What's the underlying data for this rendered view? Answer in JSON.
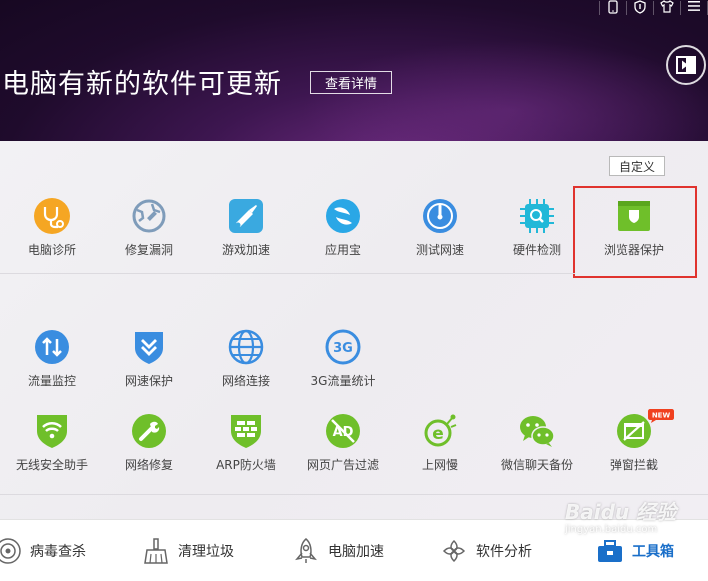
{
  "header": {
    "headline": "电脑有新的软件可更新",
    "detail_button": "查看详情",
    "top_icons": [
      "phone-icon",
      "shield-icon",
      "shirt-icon",
      "menu-icon"
    ]
  },
  "toolbar": {
    "custom_label": "自定义"
  },
  "tools_row1": [
    {
      "label": "电脑诊所",
      "icon": "stethoscope-icon",
      "color": "#f5a623"
    },
    {
      "label": "修复漏洞",
      "icon": "repair-globe-icon",
      "color": "#6f8fb0"
    },
    {
      "label": "游戏加速",
      "icon": "game-boost-icon",
      "color": "#3aa9e0"
    },
    {
      "label": "应用宝",
      "icon": "app-store-icon",
      "color": "#2aa7e6"
    },
    {
      "label": "测试网速",
      "icon": "speed-test-icon",
      "color": "#3a8de0"
    },
    {
      "label": "硬件检测",
      "icon": "chip-icon",
      "color": "#22b8d8"
    },
    {
      "label": "浏览器保护",
      "icon": "browser-shield-icon",
      "color": "#6fbf2a"
    }
  ],
  "tools_row2": [
    {
      "label": "流量监控",
      "icon": "traffic-monitor-icon",
      "color": "#3a8de0"
    },
    {
      "label": "网速保护",
      "icon": "speed-shield-icon",
      "color": "#3a8de0"
    },
    {
      "label": "网络连接",
      "icon": "network-globe-icon",
      "color": "#3a8de0"
    },
    {
      "label": "3G流量统计",
      "icon": "3g-icon",
      "color": "#3a8de0"
    }
  ],
  "tools_row3": [
    {
      "label": "无线安全助手",
      "icon": "wifi-shield-icon",
      "color": "#6fbf2a"
    },
    {
      "label": "网络修复",
      "icon": "wrench-icon",
      "color": "#6fbf2a"
    },
    {
      "label": "ARP防火墙",
      "icon": "firewall-icon",
      "color": "#6fbf2a"
    },
    {
      "label": "网页广告过滤",
      "icon": "ad-filter-icon",
      "color": "#6fbf2a"
    },
    {
      "label": "上网慢",
      "icon": "slow-internet-icon",
      "color": "#6fbf2a"
    },
    {
      "label": "微信聊天备份",
      "icon": "wechat-icon",
      "color": "#6fbf2a"
    },
    {
      "label": "弹窗拦截",
      "icon": "popup-block-icon",
      "color": "#6fbf2a",
      "badge": "NEW"
    }
  ],
  "bottom_nav": [
    {
      "label": "病毒查杀",
      "icon": "virus-scan-icon"
    },
    {
      "label": "清理垃圾",
      "icon": "broom-icon"
    },
    {
      "label": "电脑加速",
      "icon": "rocket-icon"
    },
    {
      "label": "软件分析",
      "icon": "software-icon"
    },
    {
      "label": "工具箱",
      "icon": "toolbox-icon",
      "active": true
    }
  ],
  "watermark": "Baidu 经验",
  "watermark_sub": "jingyan.baidu.com"
}
